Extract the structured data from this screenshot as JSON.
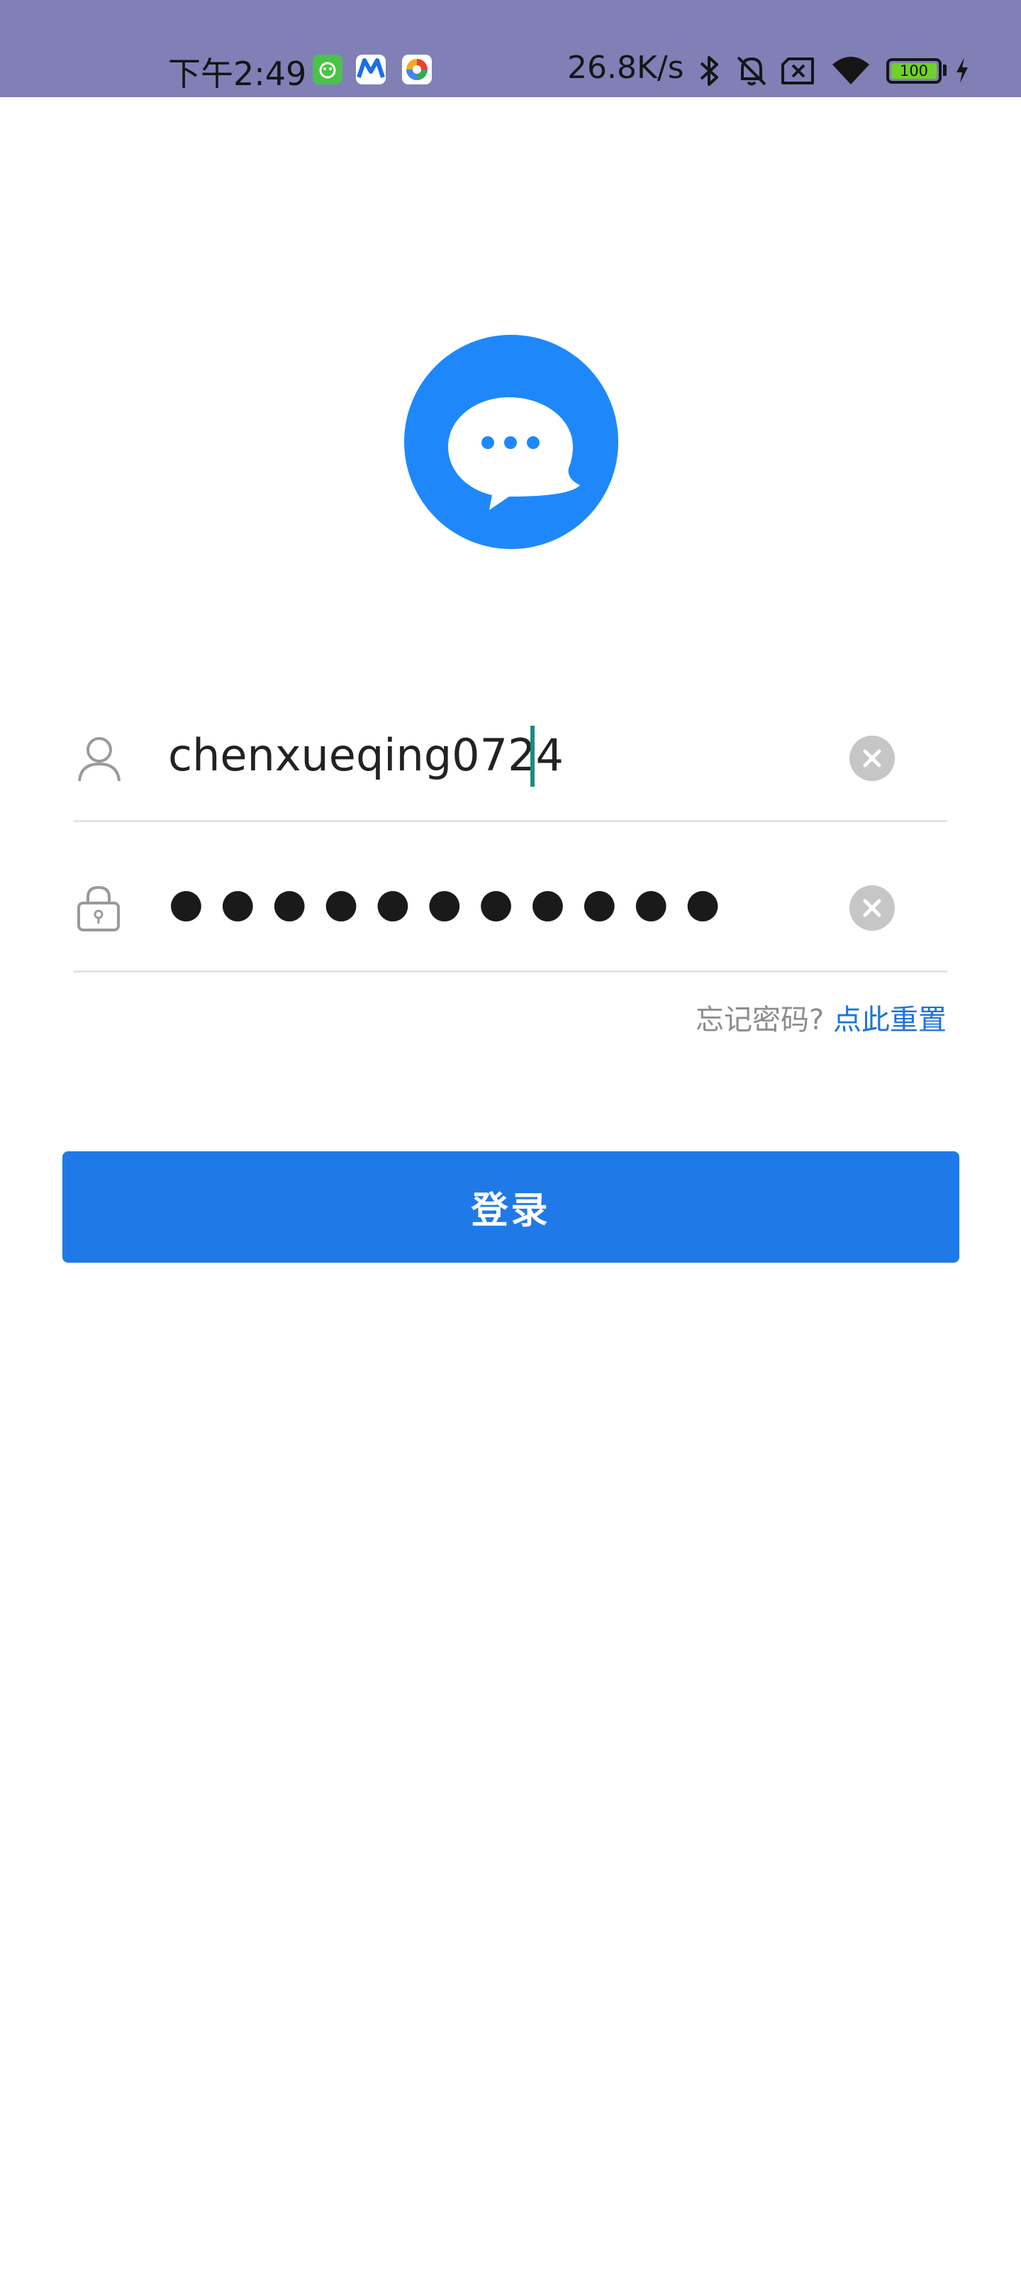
{
  "status_bar": {
    "time": "下午2:49",
    "net_speed": "26.8K/s",
    "battery_level": "100",
    "icons": [
      "app-green-icon",
      "app-m-icon",
      "app-color-icon",
      "bluetooth-icon",
      "mute-bell-icon",
      "no-sim-icon",
      "wifi-icon",
      "battery-icon",
      "charging-icon"
    ]
  },
  "logo": {
    "icon": "chat-bubble-icon",
    "color": "#1e88fb"
  },
  "login_form": {
    "username": {
      "icon": "user-icon",
      "value": "chenxueqing0724"
    },
    "password": {
      "icon": "lock-icon",
      "masked_value": "●●●●●●●●●●●"
    },
    "forgot_text": "忘记密码?",
    "reset_link": "点此重置",
    "login_button": "登录"
  },
  "colors": {
    "status_bar": "#8080b7",
    "accent": "#1f7ae8",
    "link": "#1c73d9"
  }
}
